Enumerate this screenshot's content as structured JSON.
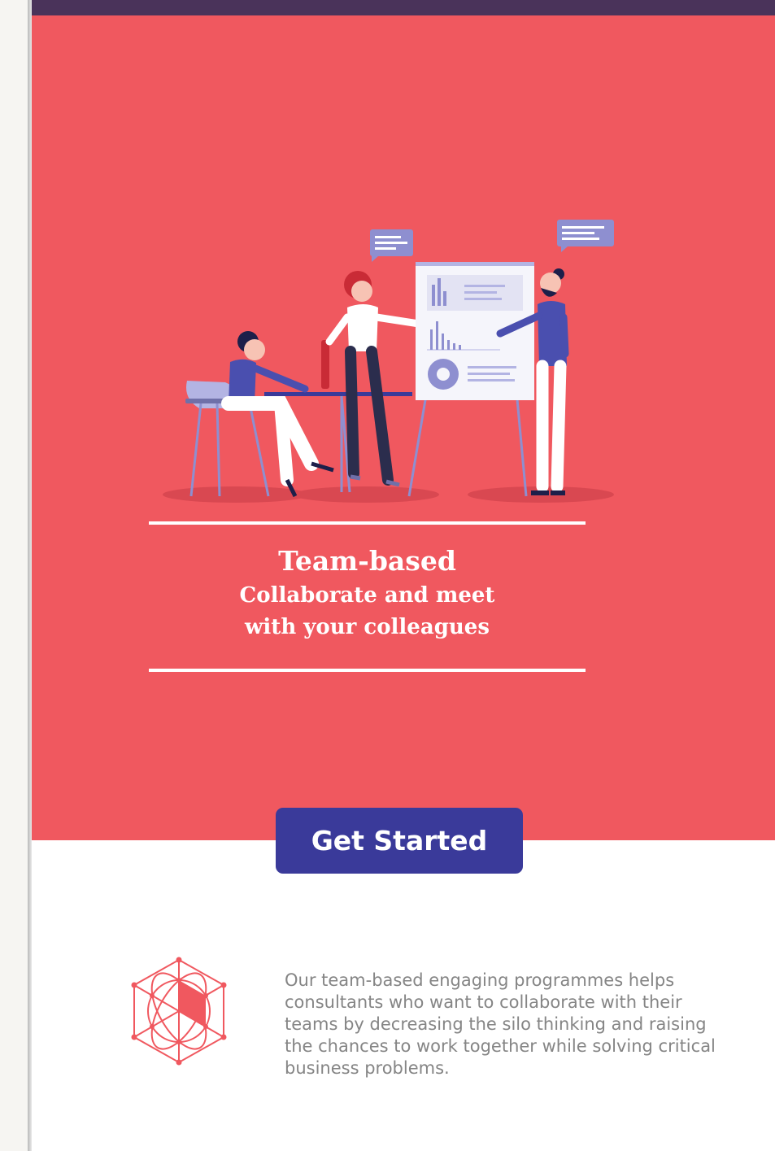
{
  "colors": {
    "hero_background": "#f0585f",
    "top_bar": "#4a335a",
    "button_background": "#3a3a9a",
    "text_on_hero": "#ffffff",
    "body_text": "#858585",
    "icon_stroke": "#f0585f"
  },
  "hero": {
    "title": "Team-based",
    "subtitle_line_1": "Collaborate and meet",
    "subtitle_line_2": "with your colleagues",
    "illustration": "team-meeting-illustration"
  },
  "cta": {
    "label": "Get Started"
  },
  "feature": {
    "icon": "network-hexagon-icon",
    "description": "Our team-based engaging programmes helps consultants who want to collaborate with their teams by decreasing the silo thinking and raising the chances to work together while solving critical business problems."
  }
}
